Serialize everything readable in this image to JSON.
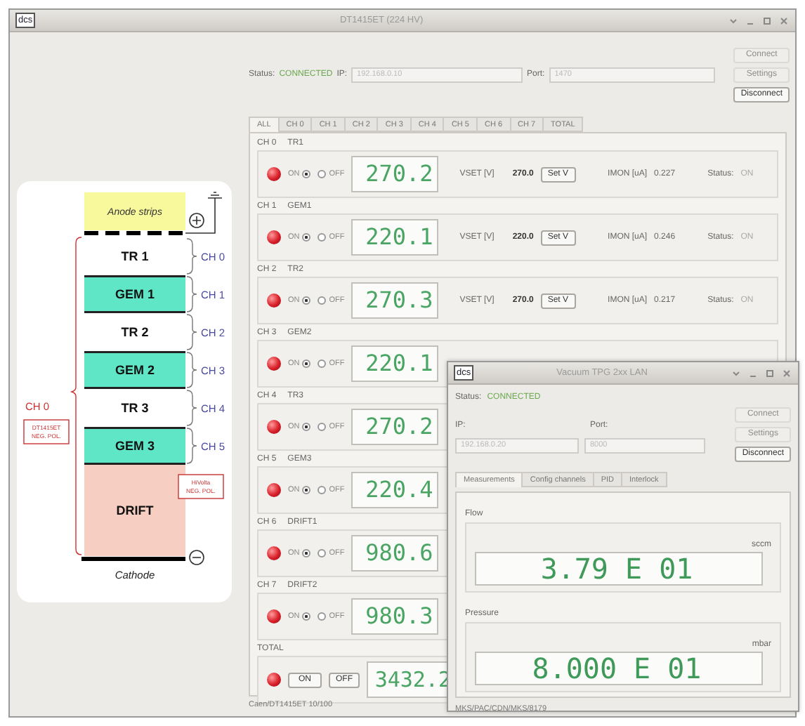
{
  "window": {
    "logo": "dcs",
    "title": "DT1415ET (224 HV)"
  },
  "connection": {
    "status_label": "Status:",
    "status": "CONNECTED",
    "ip_label": "IP:",
    "ip_placeholder": "192.168.0.10",
    "port_label": "Port:",
    "port_placeholder": "1470"
  },
  "buttons": [
    {
      "label": "Connect",
      "disabled": true
    },
    {
      "label": "Settings",
      "disabled": true
    },
    {
      "label": "Disconnect",
      "disabled": false
    }
  ],
  "tabs": [
    {
      "label": "ALL",
      "selected": true
    },
    {
      "label": "CH 0",
      "selected": false
    },
    {
      "label": "CH 1",
      "selected": false
    },
    {
      "label": "CH 2",
      "selected": false
    },
    {
      "label": "CH 3",
      "selected": false
    },
    {
      "label": "CH 4",
      "selected": false
    },
    {
      "label": "CH 5",
      "selected": false
    },
    {
      "label": "CH 6",
      "selected": false
    },
    {
      "label": "CH 7",
      "selected": false
    },
    {
      "label": "TOTAL",
      "selected": false
    }
  ],
  "channels": [
    {
      "id": "CH 0",
      "name": "TR1",
      "on": true,
      "on_label": "ON",
      "off_label": "OFF",
      "display": "270.2",
      "vset_label": "VSET [V]",
      "vset": "270.0",
      "set_button": "Set V",
      "imon_label": "IMON [uA]",
      "imon": "0.227",
      "status_label": "Status:",
      "status": "ON"
    },
    {
      "id": "CH 1",
      "name": "GEM1",
      "on": true,
      "on_label": "ON",
      "off_label": "OFF",
      "display": "220.1",
      "vset_label": "VSET [V]",
      "vset": "220.0",
      "set_button": "Set V",
      "imon_label": "IMON [uA]",
      "imon": "0.246",
      "status_label": "Status:",
      "status": "ON"
    },
    {
      "id": "CH 2",
      "name": "TR2",
      "on": true,
      "on_label": "ON",
      "off_label": "OFF",
      "display": "270.3",
      "vset_label": "VSET [V]",
      "vset": "270.0",
      "set_button": "Set V",
      "imon_label": "IMON [uA]",
      "imon": "0.217",
      "status_label": "Status:",
      "status": "ON"
    },
    {
      "id": "CH 3",
      "name": "GEM2",
      "on": true,
      "on_label": "ON",
      "off_label": "OFF",
      "display": "220.1"
    },
    {
      "id": "CH 4",
      "name": "TR3",
      "on": true,
      "on_label": "ON",
      "off_label": "OFF",
      "display": "270.2"
    },
    {
      "id": "CH 5",
      "name": "GEM3",
      "on": true,
      "on_label": "ON",
      "off_label": "OFF",
      "display": "220.4"
    },
    {
      "id": "CH 6",
      "name": "DRIFT1",
      "on": true,
      "on_label": "ON",
      "off_label": "OFF",
      "display": "980.6"
    },
    {
      "id": "CH 7",
      "name": "DRIFT2",
      "on": true,
      "on_label": "ON",
      "off_label": "OFF",
      "display": "980.3"
    }
  ],
  "total": {
    "label": "TOTAL",
    "on_button": "ON",
    "off_button": "OFF",
    "display": "3432.2"
  },
  "status_bar": "Caen/DT1415ET 10/100",
  "diagram": {
    "anode": "Anode strips",
    "layers": [
      {
        "label": "TR 1",
        "kind": "transfer"
      },
      {
        "label": "GEM 1",
        "kind": "gem"
      },
      {
        "label": "TR 2",
        "kind": "transfer"
      },
      {
        "label": "GEM 2",
        "kind": "gem"
      },
      {
        "label": "TR 3",
        "kind": "transfer"
      },
      {
        "label": "GEM 3",
        "kind": "gem"
      },
      {
        "label": "DRIFT",
        "kind": "drift"
      }
    ],
    "channel_labels": [
      "CH 0",
      "CH 1",
      "CH 2",
      "CH 3",
      "CH 4",
      "CH 5"
    ],
    "supply_label": "CH 0",
    "notes": [
      [
        "DT1415ET",
        "NEG. POL."
      ],
      [
        "HiVolta",
        "NEG. POL."
      ]
    ],
    "cathode": "Cathode"
  },
  "gauge_window": {
    "logo": "dcs",
    "title": "Vacuum TPG 2xx LAN",
    "status_label": "Status:",
    "status": "CONNECTED",
    "ip_label": "IP:",
    "port_label": "Port:",
    "ip_placeholder": "192.168.0.20",
    "port_placeholder": "8000",
    "buttons": [
      {
        "label": "Connect",
        "disabled": true
      },
      {
        "label": "Settings",
        "disabled": true
      },
      {
        "label": "Disconnect",
        "disabled": false
      }
    ],
    "tabs": [
      {
        "label": "Measurements",
        "selected": true
      },
      {
        "label": "Config channels",
        "selected": false
      },
      {
        "label": "PID",
        "selected": false
      },
      {
        "label": "Interlock",
        "selected": false
      }
    ],
    "groups": [
      {
        "title": "Flow",
        "unit": "sccm",
        "value": "3.79 E 01"
      },
      {
        "title": "Pressure",
        "unit": "mbar",
        "value": "8.000 E 01"
      }
    ],
    "status_bar": "MKS/PAC/CDN/MKS/8179"
  }
}
